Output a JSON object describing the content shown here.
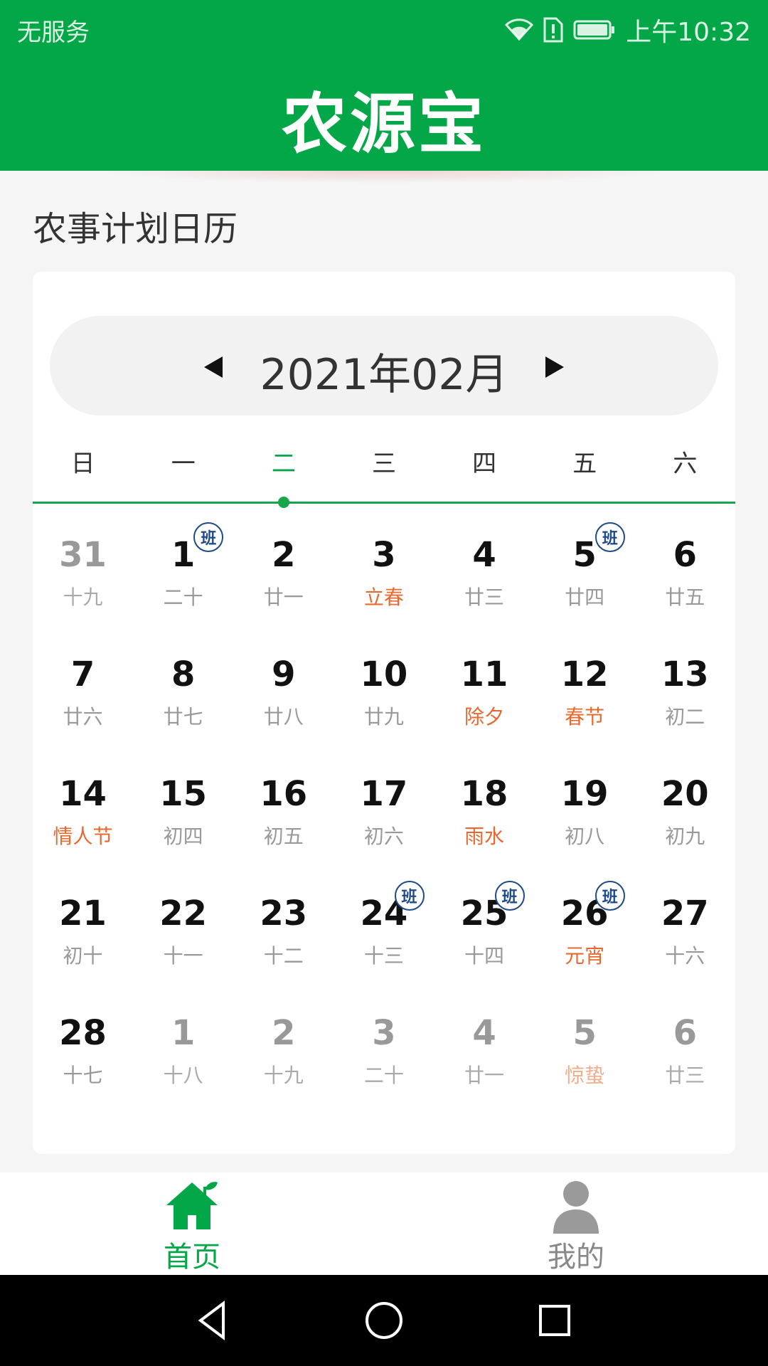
{
  "status_bar": {
    "carrier": "无服务",
    "time": "上午10:32"
  },
  "header": {
    "brand": "农源宝"
  },
  "section_title": "农事计划日历",
  "calendar": {
    "month_label": "2021年02月",
    "weekdays": [
      "日",
      "一",
      "二",
      "三",
      "四",
      "五",
      "六"
    ],
    "active_weekday_index": 2,
    "badge_label": "班",
    "weeks": [
      [
        {
          "day": "31",
          "lunar": "十九",
          "other": true
        },
        {
          "day": "1",
          "lunar": "二十",
          "badge": true
        },
        {
          "day": "2",
          "lunar": "廿一"
        },
        {
          "day": "3",
          "lunar": "立春",
          "festival": true
        },
        {
          "day": "4",
          "lunar": "廿三"
        },
        {
          "day": "5",
          "lunar": "廿四",
          "badge": true
        },
        {
          "day": "6",
          "lunar": "廿五"
        }
      ],
      [
        {
          "day": "7",
          "lunar": "廿六"
        },
        {
          "day": "8",
          "lunar": "廿七"
        },
        {
          "day": "9",
          "lunar": "廿八"
        },
        {
          "day": "10",
          "lunar": "廿九"
        },
        {
          "day": "11",
          "lunar": "除夕",
          "festival": true
        },
        {
          "day": "12",
          "lunar": "春节",
          "festival": true
        },
        {
          "day": "13",
          "lunar": "初二"
        }
      ],
      [
        {
          "day": "14",
          "lunar": "情人节",
          "festival": true
        },
        {
          "day": "15",
          "lunar": "初四"
        },
        {
          "day": "16",
          "lunar": "初五"
        },
        {
          "day": "17",
          "lunar": "初六"
        },
        {
          "day": "18",
          "lunar": "雨水",
          "festival": true
        },
        {
          "day": "19",
          "lunar": "初八"
        },
        {
          "day": "20",
          "lunar": "初九"
        }
      ],
      [
        {
          "day": "21",
          "lunar": "初十"
        },
        {
          "day": "22",
          "lunar": "十一"
        },
        {
          "day": "23",
          "lunar": "十二"
        },
        {
          "day": "24",
          "lunar": "十三",
          "badge": true
        },
        {
          "day": "25",
          "lunar": "十四",
          "badge": true
        },
        {
          "day": "26",
          "lunar": "元宵",
          "festival": true,
          "badge": true
        },
        {
          "day": "27",
          "lunar": "十六"
        }
      ],
      [
        {
          "day": "28",
          "lunar": "十七"
        },
        {
          "day": "1",
          "lunar": "十八",
          "other": true
        },
        {
          "day": "2",
          "lunar": "十九",
          "other": true
        },
        {
          "day": "3",
          "lunar": "二十",
          "other": true
        },
        {
          "day": "4",
          "lunar": "廿一",
          "other": true
        },
        {
          "day": "5",
          "lunar": "惊蛰",
          "other": true,
          "festival": true
        },
        {
          "day": "6",
          "lunar": "廿三",
          "other": true
        }
      ]
    ]
  },
  "bottom_nav": {
    "home_label": "首页",
    "mine_label": "我的"
  },
  "colors": {
    "brand_green": "#04a747",
    "festival_orange": "#e8692f",
    "badge_blue": "#1f4a8a"
  }
}
